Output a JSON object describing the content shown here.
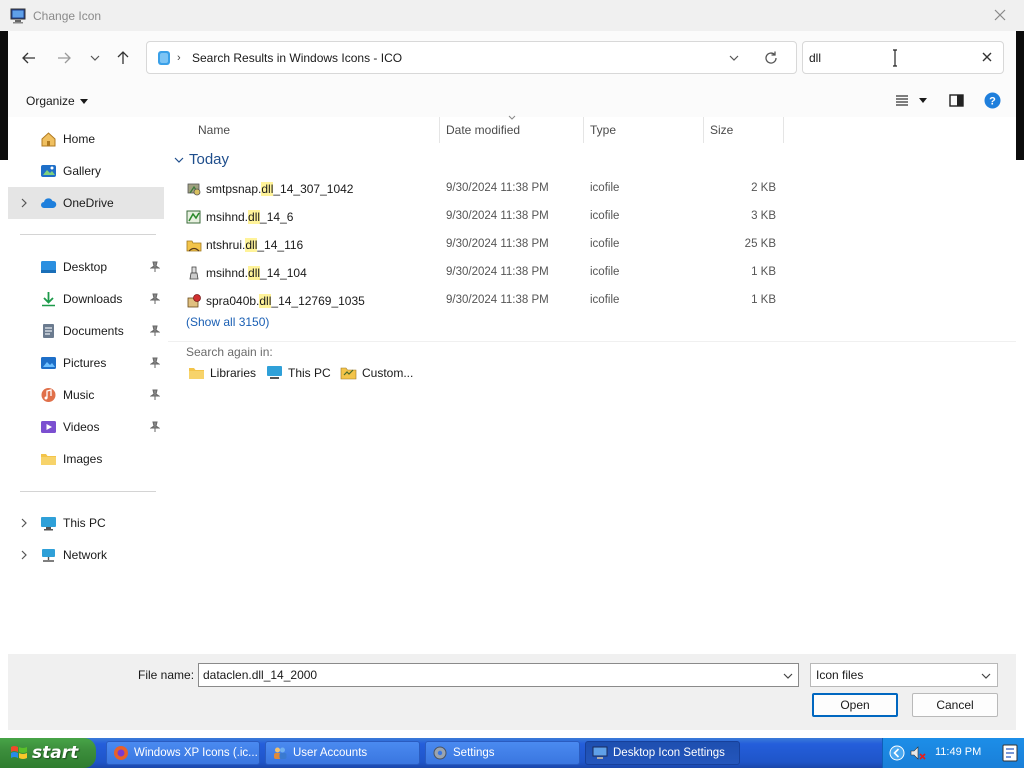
{
  "window": {
    "title": "Change Icon"
  },
  "address": {
    "path": "Search Results in Windows Icons - ICO"
  },
  "search": {
    "value": "dll"
  },
  "toolbar": {
    "organize": "Organize"
  },
  "sidebar": {
    "items": [
      {
        "label": "Home"
      },
      {
        "label": "Gallery"
      },
      {
        "label": "OneDrive"
      },
      {
        "label": "Desktop"
      },
      {
        "label": "Downloads"
      },
      {
        "label": "Documents"
      },
      {
        "label": "Pictures"
      },
      {
        "label": "Music"
      },
      {
        "label": "Videos"
      },
      {
        "label": "Images"
      },
      {
        "label": "This PC"
      },
      {
        "label": "Network"
      }
    ]
  },
  "columns": {
    "name": "Name",
    "date": "Date modified",
    "type": "Type",
    "size": "Size"
  },
  "group": {
    "label": "Today"
  },
  "files": [
    {
      "pre": "smtpsnap.",
      "hl": "dll",
      "post": "_14_307_1042",
      "date": "9/30/2024 11:38 PM",
      "type": "icofile",
      "size": "2 KB"
    },
    {
      "pre": "msihnd.",
      "hl": "dll",
      "post": "_14_6",
      "date": "9/30/2024 11:38 PM",
      "type": "icofile",
      "size": "3 KB"
    },
    {
      "pre": "ntshrui.",
      "hl": "dll",
      "post": "_14_116",
      "date": "9/30/2024 11:38 PM",
      "type": "icofile",
      "size": "25 KB"
    },
    {
      "pre": "msihnd.",
      "hl": "dll",
      "post": "_14_104",
      "date": "9/30/2024 11:38 PM",
      "type": "icofile",
      "size": "1 KB"
    },
    {
      "pre": "spra040b.",
      "hl": "dll",
      "post": "_14_12769_1035",
      "date": "9/30/2024 11:38 PM",
      "type": "icofile",
      "size": "1 KB"
    }
  ],
  "show_all": "(Show all 3150)",
  "search_again": {
    "label": "Search again in:",
    "options": [
      {
        "label": "Libraries"
      },
      {
        "label": "This PC"
      },
      {
        "label": "Custom..."
      }
    ]
  },
  "bottom": {
    "filename_label": "File name:",
    "filename_value": "dataclen.dll_14_2000",
    "filetype": "Icon files",
    "open": "Open",
    "cancel": "Cancel"
  },
  "taskbar": {
    "start": "start",
    "items": [
      {
        "label": "Windows XP Icons (.ic..."
      },
      {
        "label": "User Accounts"
      },
      {
        "label": "Settings"
      },
      {
        "label": "Desktop Icon Settings"
      }
    ],
    "clock": "11:49 PM"
  },
  "colors": {
    "accent": "#0067c0",
    "highlight": "#fff39a",
    "group": "#1f4e8c",
    "taskbar": "#245edb"
  }
}
